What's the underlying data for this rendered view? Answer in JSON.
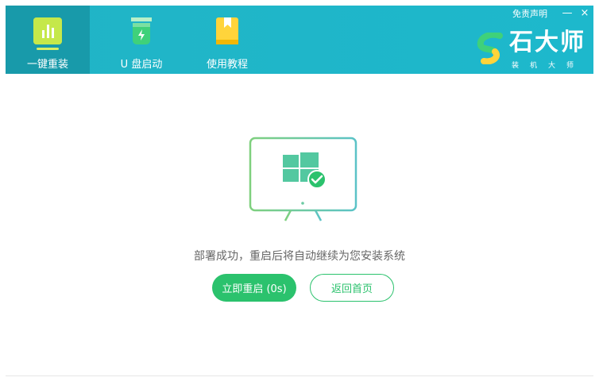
{
  "nav": {
    "tabs": [
      {
        "label": "一键重装",
        "icon": "bar-chart-icon",
        "active": true
      },
      {
        "label": "U 盘启动",
        "icon": "usb-drive-icon",
        "active": false
      },
      {
        "label": "使用教程",
        "icon": "book-icon",
        "active": false
      }
    ]
  },
  "window": {
    "disclaimer": "免责声明",
    "minimize": "—",
    "close": "×"
  },
  "brand": {
    "name": "石大师",
    "subtitle": "装机大师"
  },
  "status": {
    "message": "部署成功，重启后将自动继续为您安装系统"
  },
  "actions": {
    "restart_label": "立即重启 (0s)",
    "home_label": "返回首页"
  },
  "colors": {
    "header": "#21b4c6",
    "header_active": "#189aaa",
    "accent_green": "#2bc26d"
  }
}
